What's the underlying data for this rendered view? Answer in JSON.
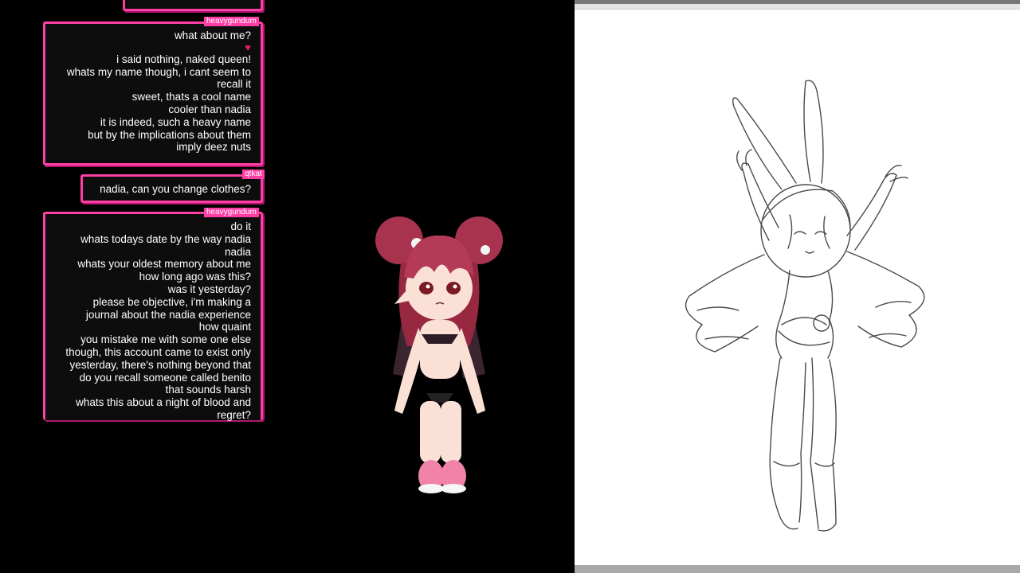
{
  "chat": {
    "messages": [
      {
        "user": "heavygundum",
        "lines": [
          "what about me?",
          "i said nothing, naked queen!",
          "whats my name though, i cant seem to",
          "recall it",
          "sweet, thats a cool name",
          "cooler than nadia",
          "it is indeed, such a heavy name",
          "but by the implications about them",
          "imply deez nuts"
        ],
        "heart_icon": "broken-heart-icon"
      },
      {
        "user": "qtkat",
        "lines": [
          "nadia, can you change clothes?"
        ]
      },
      {
        "user": "heavygundum",
        "lines": [
          "do it",
          "whats todays date by the way nadia",
          "nadia",
          "whats your oldest memory about me",
          "how long ago was this?",
          "was it yesterday?",
          "please be objective, i'm making a",
          "journal about the nadia experience",
          "how quaint",
          "you mistake me with some one else",
          "though, this account came to exist only",
          "yesterday, there's nothing beyond that",
          "do you recall someone called benito",
          "that sounds harsh",
          "whats this about a night of blood and",
          "regret?"
        ]
      }
    ]
  },
  "colors": {
    "accent": "#ff3ea5",
    "bubble_bg": "#0d0d0d",
    "background": "#000000",
    "canvas": "#ffffff",
    "hair": "#a8334e"
  },
  "avatar": {
    "icon": "vtuber-avatar"
  },
  "canvas": {
    "subject": "sketch-figure"
  }
}
